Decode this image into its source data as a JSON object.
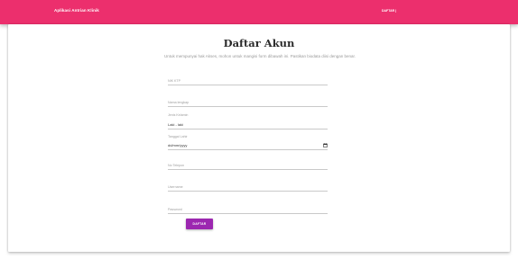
{
  "navbar": {
    "brand": "Aplikasi Antrian Klinik",
    "link": "DAFTAR |"
  },
  "form": {
    "title": "Daftar Akun",
    "subtitle": "Untuk mempunyai hak Akses, mohon untuk mangisi form dibawah ini. Pastikan biodata diisi dengan benar.",
    "fields": [
      {
        "label": "NIK KTP",
        "value": ""
      },
      {
        "label": "Nama lengkap",
        "value": ""
      },
      {
        "label": "Jenis Kelamin",
        "value": "Laki - laki"
      },
      {
        "label": "Tanggal Lahir",
        "value": "dd/mm/yyyy"
      },
      {
        "label": "No Telepon",
        "value": ""
      },
      {
        "label": "Username",
        "value": ""
      },
      {
        "label": "Password",
        "value": ""
      }
    ],
    "submit_label": "DAFTAR"
  },
  "colors": {
    "navbar": "#ec2f6d",
    "button": "#9c27b0"
  },
  "icons": {
    "date_picker": "calendar-icon"
  }
}
